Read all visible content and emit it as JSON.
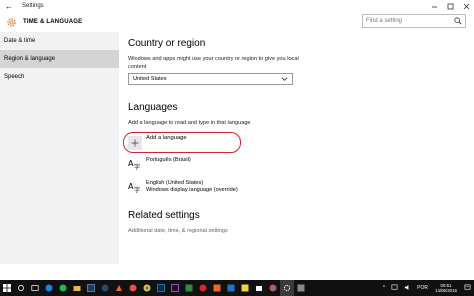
{
  "window": {
    "title": "Settings",
    "back": "←"
  },
  "header": {
    "title": "TIME & LANGUAGE",
    "search_placeholder": "Find a setting"
  },
  "sidebar": {
    "items": [
      {
        "label": "Date & time"
      },
      {
        "label": "Region & language",
        "active": true
      },
      {
        "label": "Speech"
      }
    ]
  },
  "main": {
    "country_heading": "Country or region",
    "country_desc": "Windows and apps might use your country or region to give you local content",
    "country_value": "United States",
    "languages_heading": "Languages",
    "languages_desc": "Add a language to read and type in that language",
    "add_language": "Add a language",
    "languages": [
      {
        "name": "Português (Brasil)",
        "sub": ""
      },
      {
        "name": "English (United States)",
        "sub": "Windows display language (override)"
      }
    ],
    "related_heading": "Related settings",
    "related_link": "Additional date, time, & regional settings"
  },
  "taskbar": {
    "lang": "POR",
    "time": "00:51",
    "date": "14/06/2016"
  },
  "colors": {
    "highlight_ellipse": "#d2232a",
    "sidebar_bg": "#f2f2f2",
    "active_nav": "#d4d4d4",
    "taskbar": "#111111"
  }
}
